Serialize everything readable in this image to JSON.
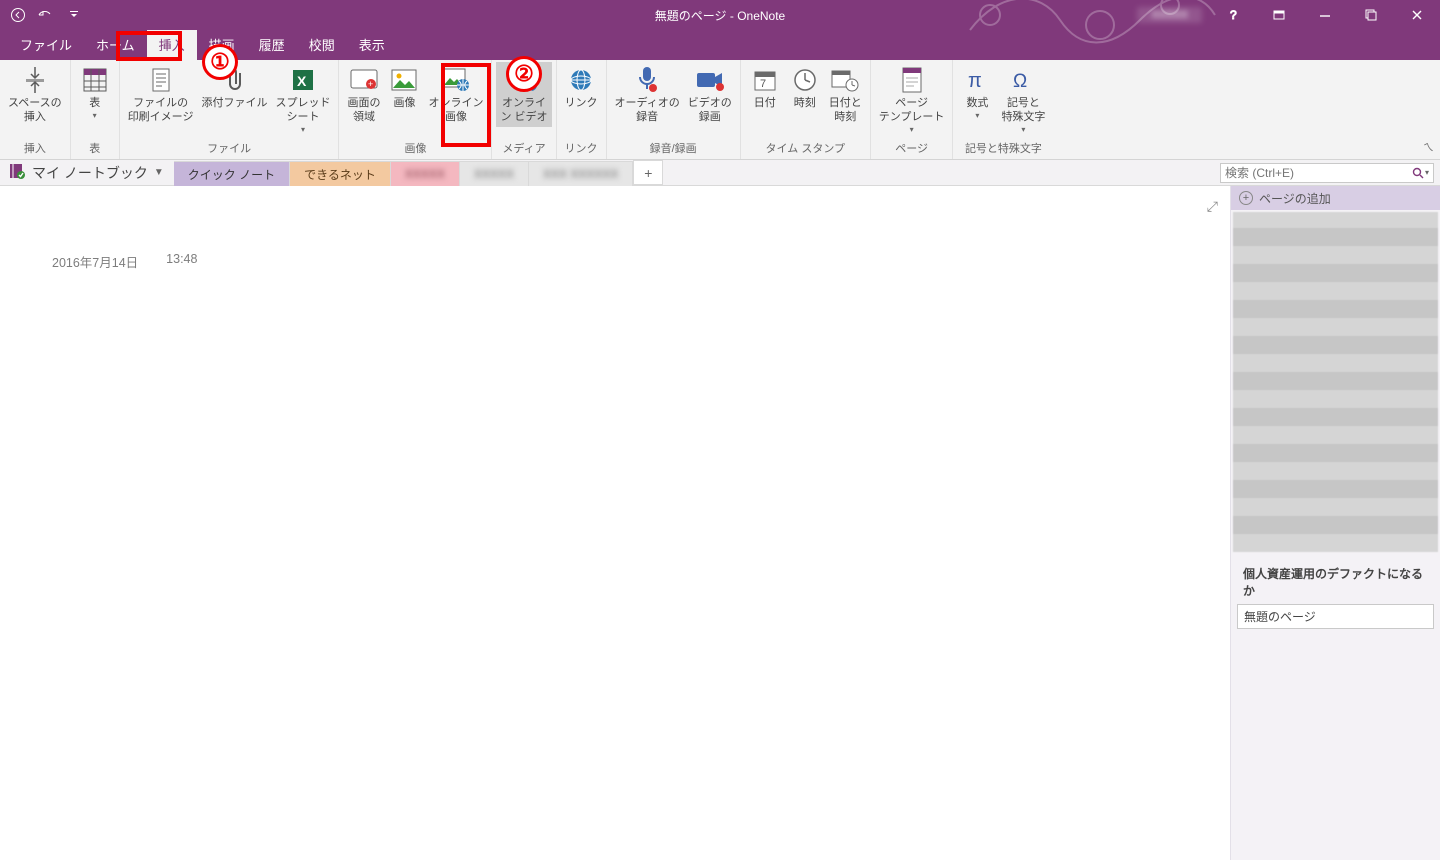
{
  "window": {
    "title": "無題のページ - OneNote",
    "account": "XXXXX"
  },
  "tabs": {
    "file": "ファイル",
    "home": "ホーム",
    "insert": "挿入",
    "draw": "描画",
    "history": "履歴",
    "review": "校閲",
    "view": "表示"
  },
  "ribbon": {
    "groups": {
      "insertSpace": {
        "label": "挿入",
        "btn": "スペースの\n挿入"
      },
      "table": {
        "label": "表",
        "btn": "表"
      },
      "file": {
        "label": "ファイル",
        "printout": "ファイルの\n印刷イメージ",
        "attach": "添付ファイル",
        "spreadsheet": "スプレッド\nシート"
      },
      "image": {
        "label": "画像",
        "screenclip": "画面の\n領域",
        "picture": "画像",
        "online": "オンライン\n画像"
      },
      "media": {
        "label": "メディア",
        "onlinevideo": "オンライ\nン ビデオ"
      },
      "link": {
        "label": "リンク",
        "link": "リンク"
      },
      "rec": {
        "label": "録音/録画",
        "audio": "オーディオの\n録音",
        "video": "ビデオの\n録画"
      },
      "timestamp": {
        "label": "タイム スタンプ",
        "date": "日付",
        "time": "時刻",
        "datetime": "日付と\n時刻"
      },
      "page": {
        "label": "ページ",
        "template": "ページ\nテンプレート"
      },
      "symbols": {
        "label": "記号と特殊文字",
        "equation": "数式",
        "symbol": "記号と\n特殊文字"
      }
    }
  },
  "notebook": {
    "picker": "マイ ノートブック"
  },
  "sections": {
    "s1": "クイック ノート",
    "s2": "できるネット",
    "s3": "XXXXX",
    "s4": "XXXXX",
    "s5": "XXX  XXXXXX"
  },
  "search": {
    "placeholder": "検索 (Ctrl+E)"
  },
  "page": {
    "date": "2016年7月14日",
    "time": "13:48"
  },
  "pagepane": {
    "add": "ページの追加",
    "item1": "個人資産運用のデファクトになるか",
    "item2": "無題のページ"
  },
  "callouts": {
    "c1": "①",
    "c2": "②"
  }
}
